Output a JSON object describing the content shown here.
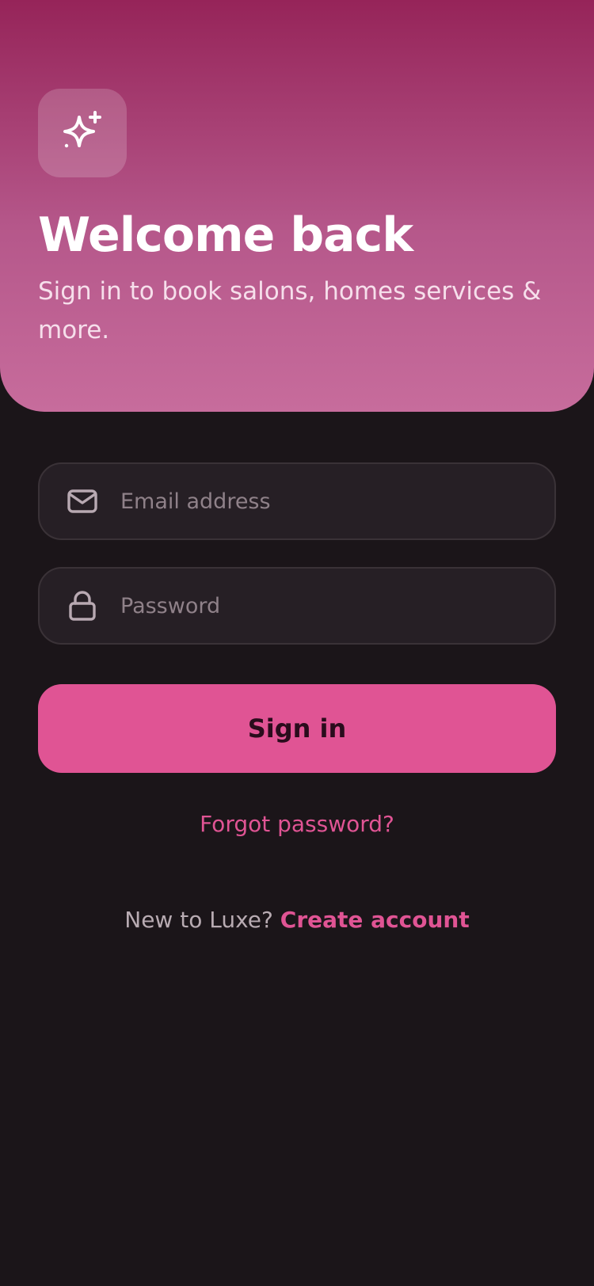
{
  "colors": {
    "background": "#1b1519",
    "accent": "#e05494",
    "hero_top": "#962459",
    "hero_bottom": "#c76c9c",
    "field_background": "#261f25"
  },
  "header": {
    "logo_icon": "sparkle-icon",
    "title": "Welcome back",
    "subtitle": "Sign in to book salons, homes services & more."
  },
  "form": {
    "email": {
      "icon": "mail-icon",
      "placeholder": "Email address",
      "value": ""
    },
    "password": {
      "icon": "lock-icon",
      "placeholder": "Password",
      "value": ""
    },
    "submit_label": "Sign in",
    "forgot_label": "Forgot password?"
  },
  "footer": {
    "prompt": "New to Luxe? ",
    "create_label": "Create account"
  }
}
